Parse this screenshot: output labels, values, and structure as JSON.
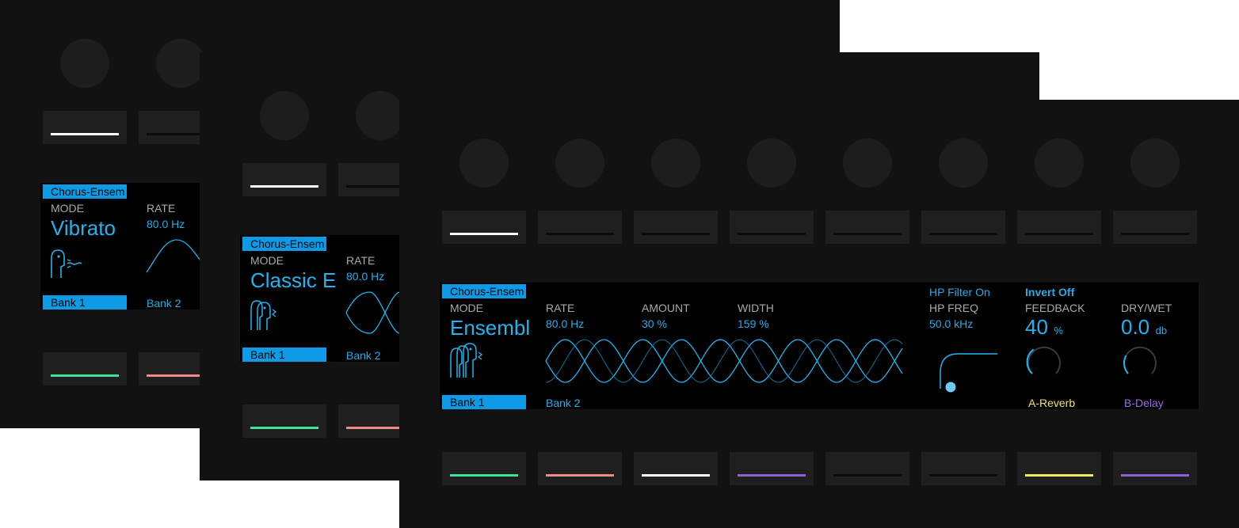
{
  "colors": {
    "accent": "#22b3ee",
    "green": "#3ee29a",
    "red": "#ef8a8a",
    "white": "#ffffff",
    "purple": "#8a63d8",
    "yellow": "#f2ea64",
    "reverb": "#f0e46a",
    "delay": "#9a6ee0"
  },
  "panel1": {
    "title": "Chorus-Ensem",
    "mode_label": "MODE",
    "mode_value": "Vibrato",
    "rate_label": "RATE",
    "rate_value": "80.0 Hz",
    "bank1": "Bank 1",
    "bank2": "Bank 2",
    "icon": "single-voice-icon"
  },
  "panel2": {
    "title": "Chorus-Ensem",
    "mode_label": "MODE",
    "mode_value": "Classic E",
    "rate_label": "RATE",
    "rate_value": "80.0 Hz",
    "bank1": "Bank 1",
    "bank2": "Bank 2",
    "icon": "two-voices-icon"
  },
  "panel3": {
    "title": "Chorus-Ensem",
    "mode_label": "MODE",
    "mode_value": "Ensembl",
    "rate_label": "RATE",
    "rate_value": "80.0 Hz",
    "amount_label": "AMOUNT",
    "amount_value": "30 %",
    "width_label": "WIDTH",
    "width_value": "159 %",
    "hp_filter": "HP Filter On",
    "hp_freq_label": "HP FREQ",
    "hp_freq_value": "50.0 kHz",
    "invert": "Invert Off",
    "feedback_label": "FEEDBACK",
    "feedback_value": "40",
    "feedback_unit": "%",
    "feedback_level": 0.4,
    "drywet_label": "DRY/WET",
    "drywet_value": "0.0",
    "drywet_unit": "db",
    "bank1": "Bank 1",
    "bank2": "Bank 2",
    "a_reverb": "A-Reverb",
    "b_delay": "B-Delay",
    "icon": "three-voices-icon",
    "top_buttons_active": [
      true,
      false,
      false,
      false,
      false,
      false,
      false,
      false
    ],
    "bottom_button_colors": [
      "green",
      "red",
      "white",
      "purple",
      "off",
      "off",
      "yellow",
      "purple"
    ]
  }
}
